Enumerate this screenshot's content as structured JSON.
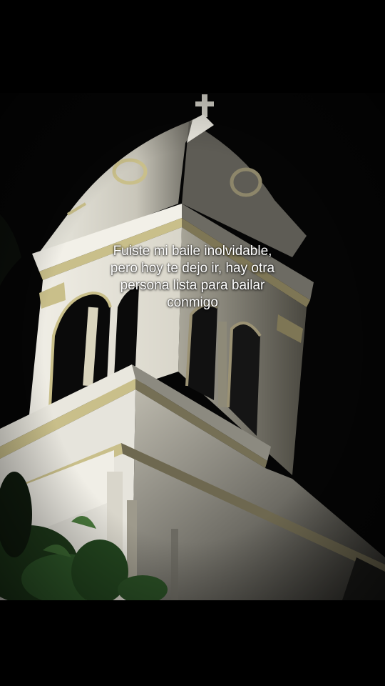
{
  "caption": {
    "line1": "Fuiste mi baile inolvidable,",
    "line2": "pero hoy te dejo ir, hay otra",
    "line3": "persona lista para bailar",
    "line4": "conmigo"
  },
  "colors": {
    "background": "#000000",
    "tower_light": "#e4e2d8",
    "tower_trim": "#c9bf8a",
    "foliage": "#2f5a2a",
    "caption_text": "#ffffff"
  }
}
